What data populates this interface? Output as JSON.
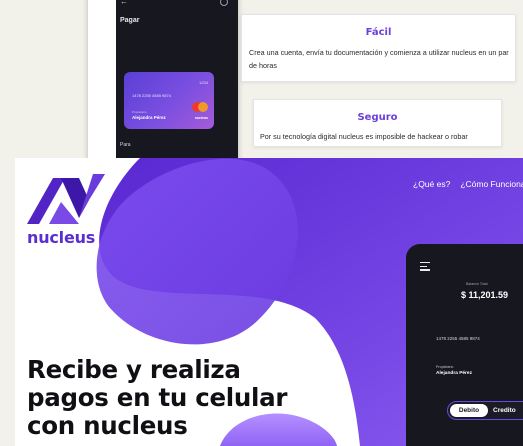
{
  "app_preview_top": {
    "title": "Pagar",
    "back_icon": "arrow-left-icon",
    "footer_label": "Para",
    "card": {
      "number": "1478 2255 4585 9874",
      "cvv": "1234",
      "owner_label": "Propietario",
      "owner": "Alejandra Pérez",
      "brand": "nucleus"
    }
  },
  "features": [
    {
      "title": "Fácil",
      "text": "Crea una cuenta, envía tu documentación y comienza a utilizar nucleus en un par de horas"
    },
    {
      "title": "Seguro",
      "text": "Por su tecnología digital nucleus es imposible de hackear o robar"
    }
  ],
  "hero": {
    "logo_text": "nucleus",
    "nav": [
      "¿Qué es?",
      "¿Cómo Funciona?"
    ],
    "headline": [
      "Recibe y realiza",
      "pagos en tu celular",
      "con nucleus"
    ],
    "phone": {
      "balance_label": "Balance Total",
      "balance": "$ 11,201.59",
      "card_number": "1478 2255 4585 9874",
      "owner_label": "Propietario",
      "owner": "Alejandra Pérez",
      "toggle": [
        "Debito",
        "Credito"
      ]
    }
  },
  "colors": {
    "accent": "#6b3fd8",
    "purple_dark": "#4a1fb8",
    "purple_light": "#8a5cf0",
    "phone_bg": "#17171f"
  }
}
